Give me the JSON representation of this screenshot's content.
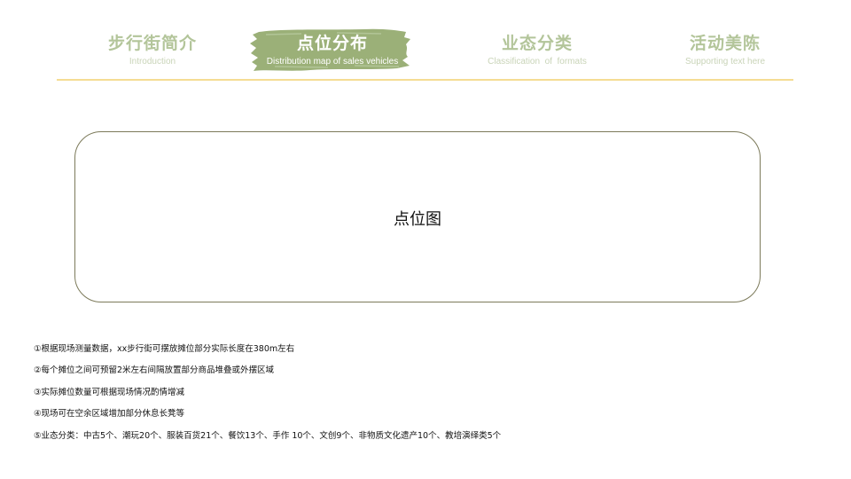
{
  "nav": {
    "tabs": [
      {
        "title": "步行街简介",
        "subtitle": "Introduction"
      },
      {
        "title": "点位分布",
        "subtitle": "Distribution map of sales vehicles"
      },
      {
        "title": "业态分类",
        "subtitle": "Classification  of  formats"
      },
      {
        "title": "活动美陈",
        "subtitle": "Supporting text here"
      }
    ],
    "active_index": 1,
    "accent_color": "#9bb078",
    "line_color": "#f5dc93"
  },
  "map_box": {
    "label": "点位图"
  },
  "notes": [
    "①根据现场测量数据，xx步行街可摆放摊位部分实际长度在380m左右",
    "②每个摊位之间可预留2米左右间隔放置部分商品堆叠或外摆区域",
    "③实际摊位数量可根据现场情况酌情增减",
    "④现场可在空余区域增加部分休息长凳等",
    "⑤业态分类：中古5个、潮玩20个、服装百货21个、餐饮13个、手作 10个、文创9个、非物质文化遗产10个、教培演绎类5个"
  ]
}
